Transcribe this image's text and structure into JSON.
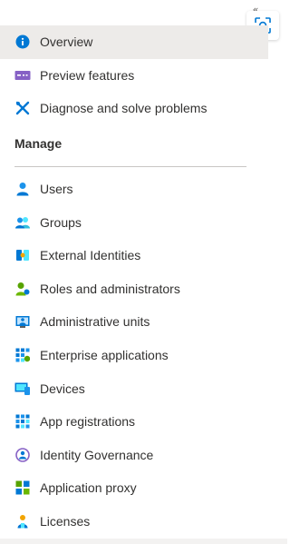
{
  "top_items": [
    {
      "label": "Overview",
      "icon": "info-icon",
      "selected": true
    },
    {
      "label": "Preview features",
      "icon": "preview-features-icon",
      "selected": false
    },
    {
      "label": "Diagnose and solve problems",
      "icon": "wrench-cross-icon",
      "selected": false
    }
  ],
  "section": {
    "title": "Manage"
  },
  "manage_items": [
    {
      "label": "Users",
      "icon": "user-icon"
    },
    {
      "label": "Groups",
      "icon": "groups-icon"
    },
    {
      "label": "External Identities",
      "icon": "external-identities-icon"
    },
    {
      "label": "Roles and administrators",
      "icon": "roles-icon"
    },
    {
      "label": "Administrative units",
      "icon": "administrative-units-icon"
    },
    {
      "label": "Enterprise applications",
      "icon": "enterprise-apps-icon"
    },
    {
      "label": "Devices",
      "icon": "devices-icon"
    },
    {
      "label": "App registrations",
      "icon": "app-registrations-icon"
    },
    {
      "label": "Identity Governance",
      "icon": "identity-governance-icon"
    },
    {
      "label": "Application proxy",
      "icon": "application-proxy-icon"
    },
    {
      "label": "Licenses",
      "icon": "licenses-icon"
    }
  ],
  "colors": {
    "accent_blue": "#0078d4",
    "selected_bg": "#edebe9",
    "purple": "#8661c5",
    "green": "#57a300"
  }
}
